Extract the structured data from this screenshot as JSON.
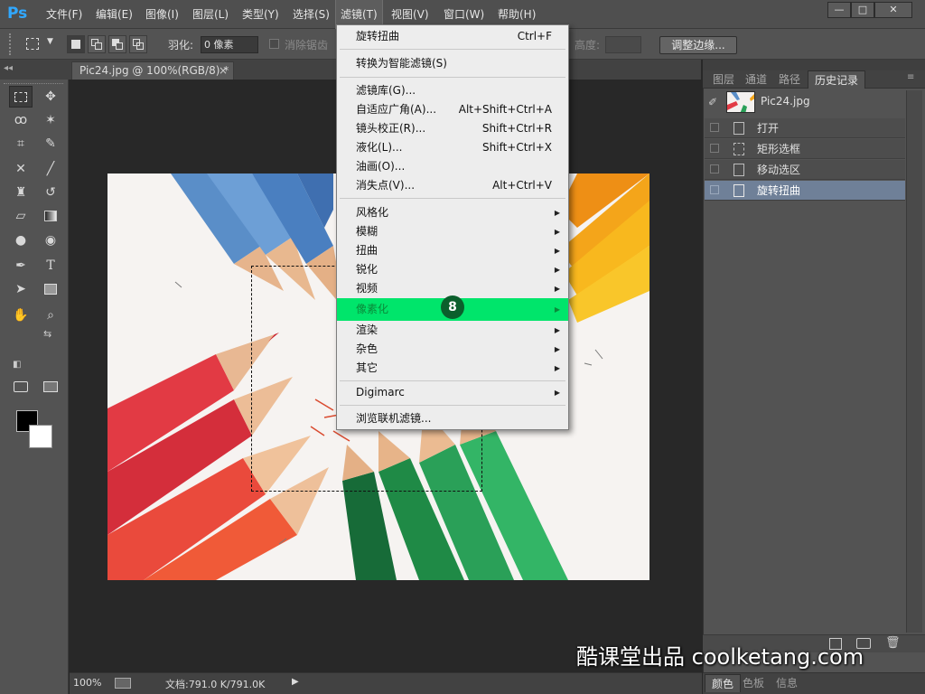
{
  "app": {
    "logo": "Ps"
  },
  "menubar": {
    "items": [
      "文件(F)",
      "编辑(E)",
      "图像(I)",
      "图层(L)",
      "类型(Y)",
      "选择(S)",
      "滤镜(T)",
      "视图(V)",
      "窗口(W)",
      "帮助(H)"
    ],
    "active": "滤镜(T)"
  },
  "window_controls": {
    "minimize": "—",
    "maximize": "□",
    "close": "✕"
  },
  "options": {
    "feather_label": "羽化:",
    "feather_value": "0 像素",
    "antialias_label": "消除锯齿",
    "height_label": "高度:",
    "refine_edge": "调整边缘..."
  },
  "document": {
    "tab_title": "Pic24.jpg @ 100%(RGB/8) *",
    "tab_close": "×"
  },
  "status": {
    "zoom": "100%",
    "doc_info": "文档:791.0 K/791.0K",
    "arrow": "▶"
  },
  "filter_menu": {
    "items": [
      {
        "label": "旋转扭曲",
        "shortcut": "Ctrl+F"
      },
      {
        "label": "转换为智能滤镜(S)",
        "shortcut": ""
      },
      {
        "label": "滤镜库(G)...",
        "shortcut": ""
      },
      {
        "label": "自适应广角(A)...",
        "shortcut": "Alt+Shift+Ctrl+A"
      },
      {
        "label": "镜头校正(R)...",
        "shortcut": "Shift+Ctrl+R"
      },
      {
        "label": "液化(L)...",
        "shortcut": "Shift+Ctrl+X"
      },
      {
        "label": "油画(O)...",
        "shortcut": ""
      },
      {
        "label": "消失点(V)...",
        "shortcut": "Alt+Ctrl+V"
      },
      {
        "label": "风格化",
        "submenu": true
      },
      {
        "label": "模糊",
        "submenu": true
      },
      {
        "label": "扭曲",
        "submenu": true
      },
      {
        "label": "锐化",
        "submenu": true
      },
      {
        "label": "视频",
        "submenu": true
      },
      {
        "label": "像素化",
        "submenu": true,
        "highlighted": true
      },
      {
        "label": "渲染",
        "submenu": true
      },
      {
        "label": "杂色",
        "submenu": true
      },
      {
        "label": "其它",
        "submenu": true
      },
      {
        "label": "Digimarc",
        "submenu": true
      },
      {
        "label": "浏览联机滤镜...",
        "shortcut": ""
      }
    ],
    "step_badge": "8",
    "highlight_color": "#00e56b"
  },
  "panel": {
    "tabs": [
      "图层",
      "通道",
      "路径",
      "历史记录"
    ],
    "active_tab": "历史记录",
    "snapshot_name": "Pic24.jpg",
    "history": [
      {
        "label": "打开",
        "icon": "document-icon"
      },
      {
        "label": "矩形选框",
        "icon": "marquee-icon"
      },
      {
        "label": "移动选区",
        "icon": "document-icon"
      },
      {
        "label": "旋转扭曲",
        "icon": "document-icon",
        "current": true
      }
    ]
  },
  "bottom_panel": {
    "tabs": [
      "颜色",
      "色板",
      "信息"
    ],
    "active_tab": "颜色"
  },
  "watermark": "酷课堂出品 coolketang.com"
}
